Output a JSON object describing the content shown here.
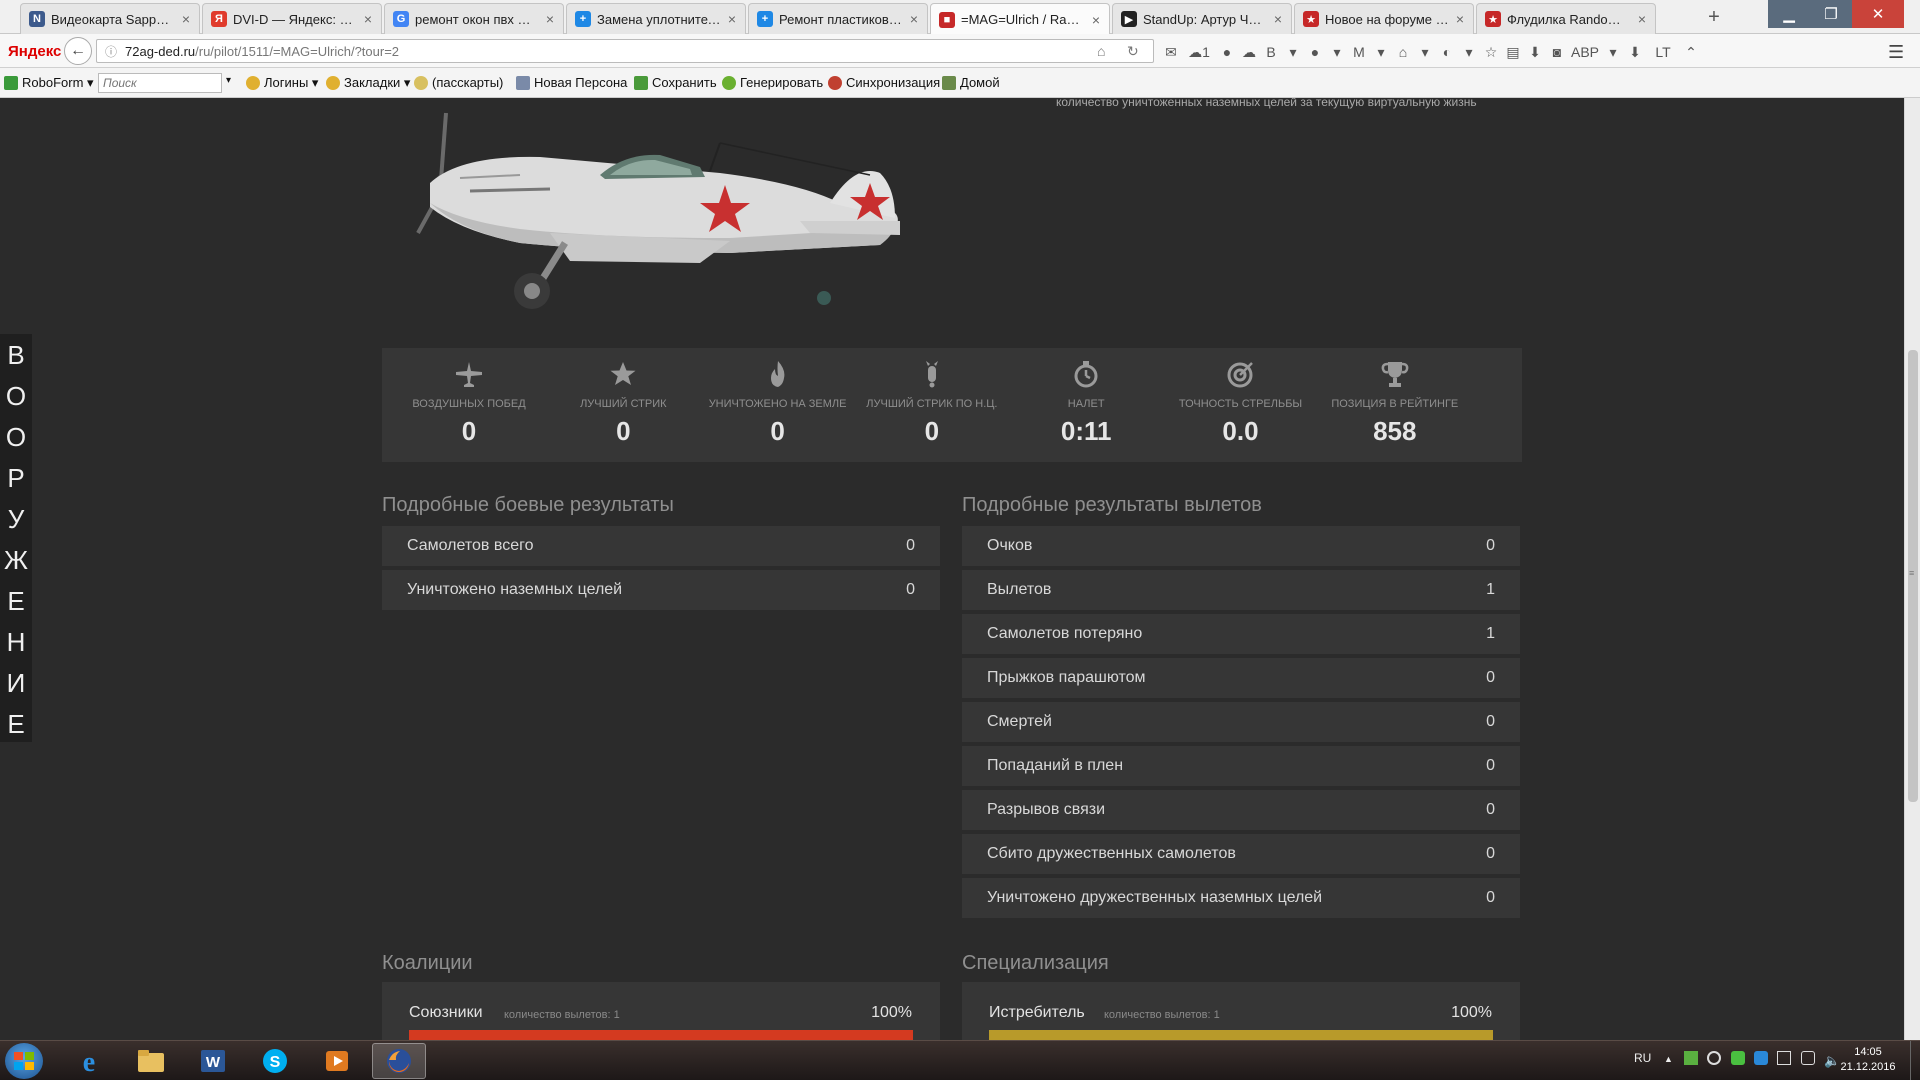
{
  "browser": {
    "tabs": [
      {
        "title": "Видеокарта Sapphire...",
        "fav": "N",
        "color": "#3c5a8c"
      },
      {
        "title": "DVI-D — Яндекс: на...",
        "fav": "Я",
        "color": "#e03b2c"
      },
      {
        "title": "ремонт окон пвх ми...",
        "fav": "G",
        "color": "#4285f4"
      },
      {
        "title": "Замена уплотнителя...",
        "fav": "+",
        "color": "#1e88e5"
      },
      {
        "title": "Ремонт пластиковых...",
        "fav": "+",
        "color": "#1e88e5"
      },
      {
        "title": "=MAG=Ulrich / Rand...",
        "fav": "■",
        "color": "#c62828",
        "active": true
      },
      {
        "title": "StandUp: Артур Чап...",
        "fav": "▶",
        "color": "#222222"
      },
      {
        "title": "Новое на форуме - ...",
        "fav": "★",
        "color": "#c62828"
      },
      {
        "title": "Флудилка Random E...",
        "fav": "★",
        "color": "#c62828"
      }
    ],
    "tab_close": "×",
    "new_tab": "+",
    "window_controls": {
      "minimize": "▁",
      "maximize": "❐",
      "close": "✕"
    },
    "yandex_logo": "Яндекс",
    "back": "←",
    "url_host": "72ag-ded.ru",
    "url_path": "/ru/pilot/1511/=MAG=Ulrich/?tour=2",
    "url_info": "ⓘ",
    "url_home": "⌂",
    "url_reload": "↻",
    "nav_icons": [
      "✉",
      "☁1",
      "●",
      "☁",
      "B",
      "▾",
      "●",
      "▾",
      "M",
      "▾",
      "⌂",
      "▾",
      "◐",
      "▾",
      "☆",
      "▤",
      "⬇",
      "◙",
      "ABP",
      "▾",
      "⬇",
      "LT",
      "⌃"
    ],
    "menu": "☰",
    "bookmarks": {
      "roboform": "RoboForm ▾",
      "search_placeholder": "Поиск",
      "search_arrow": "▾",
      "items": [
        "Логины ▾",
        "Закладки ▾",
        "(пасскарты)",
        "Новая Персона",
        "Сохранить",
        "Генерировать",
        "Синхронизация",
        "Домой"
      ]
    }
  },
  "page": {
    "top_note": "количество уничтоженных наземных целей за текущую виртуальную жизнь",
    "side_vertical": [
      "В",
      "О",
      "О",
      "Р",
      "У",
      "Ж",
      "Е",
      "Н",
      "И",
      "Е"
    ],
    "stats": [
      {
        "label": "Воздушных побед",
        "value": "0",
        "icon": "plane-icon"
      },
      {
        "label": "Лучший стрик",
        "value": "0",
        "icon": "star-icon"
      },
      {
        "label": "Уничтожено на земле",
        "value": "0",
        "icon": "fire-icon"
      },
      {
        "label": "Лучший стрик по н.ц.",
        "value": "0",
        "icon": "bomb-icon"
      },
      {
        "label": "Налет",
        "value": "0:11",
        "icon": "stopwatch-icon"
      },
      {
        "label": "Точность стрельбы",
        "value": "0.0",
        "icon": "target-icon"
      },
      {
        "label": "Позиция в рейтинге",
        "value": "858",
        "icon": "trophy-icon"
      }
    ],
    "combat": {
      "title": "Подробные боевые результаты",
      "rows": [
        {
          "name": "Самолетов всего",
          "value": "0"
        },
        {
          "name": "Уничтожено наземных целей",
          "value": "0"
        }
      ]
    },
    "sorties": {
      "title": "Подробные результаты вылетов",
      "rows": [
        {
          "name": "Очков",
          "value": "0"
        },
        {
          "name": "Вылетов",
          "value": "1"
        },
        {
          "name": "Самолетов потеряно",
          "value": "1"
        },
        {
          "name": "Прыжков парашютом",
          "value": "0"
        },
        {
          "name": "Смертей",
          "value": "0"
        },
        {
          "name": "Попаданий в плен",
          "value": "0"
        },
        {
          "name": "Разрывов связи",
          "value": "0"
        },
        {
          "name": "Сбито дружественных самолетов",
          "value": "0"
        },
        {
          "name": "Уничтожено дружественных наземных целей",
          "value": "0"
        }
      ]
    },
    "coalitions": {
      "title": "Коалиции",
      "name": "Союзники",
      "sub": "количество вылетов: 1",
      "percent": "100%",
      "fraction": 1.0,
      "color": "#d43a20"
    },
    "specialization": {
      "title": "Специализация",
      "name": "Истребитель",
      "sub": "количество вылетов: 1",
      "percent": "100%",
      "fraction": 1.0,
      "color": "#b89a2a"
    }
  },
  "taskbar": {
    "lang": "RU",
    "tray_arrow": "▲",
    "time": "14:05",
    "date": "21.12.2016"
  }
}
